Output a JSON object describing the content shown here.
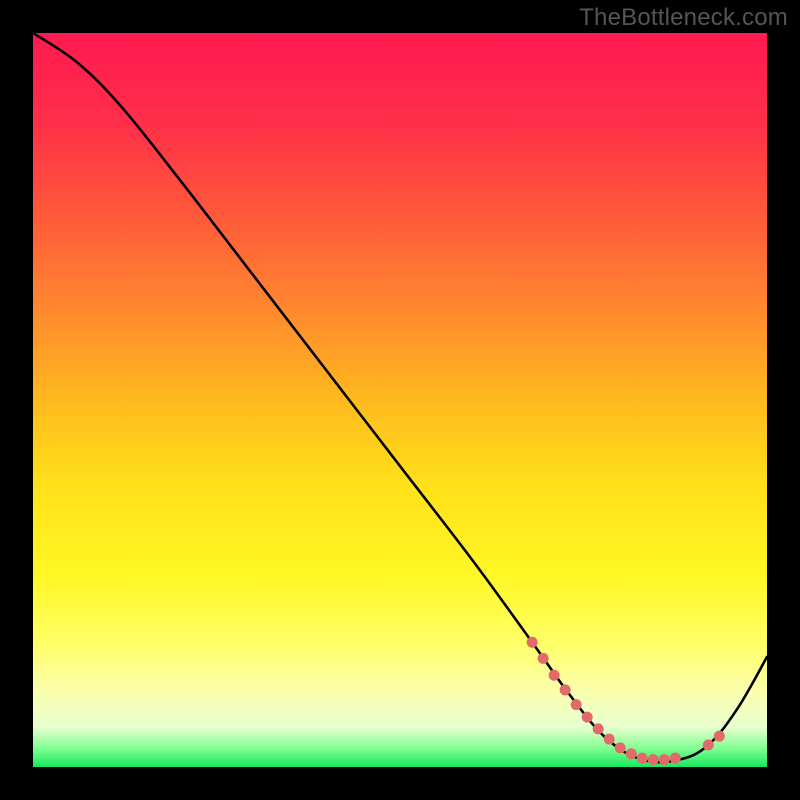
{
  "watermark": {
    "text": "TheBottleneck.com"
  },
  "gradient": {
    "stops": [
      {
        "offset": 0.0,
        "color": "#ff1a4f"
      },
      {
        "offset": 0.12,
        "color": "#ff2e49"
      },
      {
        "offset": 0.25,
        "color": "#ff5a3a"
      },
      {
        "offset": 0.38,
        "color": "#ff8a2e"
      },
      {
        "offset": 0.5,
        "color": "#ffb91f"
      },
      {
        "offset": 0.62,
        "color": "#ffe21a"
      },
      {
        "offset": 0.74,
        "color": "#fff726"
      },
      {
        "offset": 0.83,
        "color": "#ffff66"
      },
      {
        "offset": 0.9,
        "color": "#faffb0"
      },
      {
        "offset": 0.945,
        "color": "#e9ffd0"
      },
      {
        "offset": 0.975,
        "color": "#80ff90"
      },
      {
        "offset": 1.0,
        "color": "#17e860"
      }
    ]
  },
  "chart_data": {
    "type": "line",
    "title": "",
    "xlabel": "",
    "ylabel": "",
    "xlim": [
      0,
      100
    ],
    "ylim": [
      0,
      100
    ],
    "series": [
      {
        "name": "curve",
        "x": [
          0,
          6,
          12,
          20,
          30,
          40,
          50,
          60,
          68,
          73,
          78,
          83,
          88,
          92,
          96,
          100
        ],
        "y": [
          100,
          96,
          90,
          80,
          67,
          54,
          41,
          28,
          17,
          10,
          4,
          1,
          1,
          3,
          8,
          15
        ]
      }
    ],
    "markers": {
      "name": "dotted-segment",
      "color": "#e26a6a",
      "points": [
        {
          "x": 68.0,
          "y": 17.0
        },
        {
          "x": 69.5,
          "y": 14.8
        },
        {
          "x": 71.0,
          "y": 12.5
        },
        {
          "x": 72.5,
          "y": 10.5
        },
        {
          "x": 74.0,
          "y": 8.5
        },
        {
          "x": 75.5,
          "y": 6.8
        },
        {
          "x": 77.0,
          "y": 5.2
        },
        {
          "x": 78.5,
          "y": 3.8
        },
        {
          "x": 80.0,
          "y": 2.6
        },
        {
          "x": 81.5,
          "y": 1.8
        },
        {
          "x": 83.0,
          "y": 1.2
        },
        {
          "x": 84.5,
          "y": 1.0
        },
        {
          "x": 86.0,
          "y": 1.0
        },
        {
          "x": 87.5,
          "y": 1.2
        },
        {
          "x": 92.0,
          "y": 3.0
        },
        {
          "x": 93.5,
          "y": 4.2
        }
      ]
    }
  }
}
